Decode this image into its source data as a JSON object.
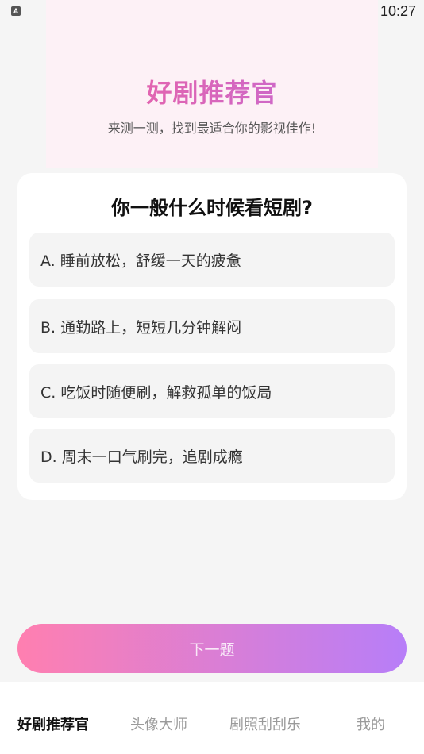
{
  "status_bar": {
    "app_icon_letter": "A",
    "time": "10:27",
    "icons": [
      "wifi-icon",
      "signal-icon",
      "battery-icon"
    ]
  },
  "hero": {
    "title": "好剧推荐官",
    "subtitle": "来测一测，找到最适合你的影视佳作!"
  },
  "quiz": {
    "question": "你一般什么时候看短剧?",
    "options": [
      {
        "label": "A. 睡前放松，舒缓一天的疲惫"
      },
      {
        "label": "B. 通勤路上，短短几分钟解闷"
      },
      {
        "label": "C. 吃饭时随便刷，解救孤单的饭局"
      },
      {
        "label": "D. 周末一口气刷完，追剧成瘾"
      }
    ]
  },
  "next_button": {
    "label": "下一题"
  },
  "tabs": [
    {
      "label": "好剧推荐官",
      "active": true
    },
    {
      "label": "头像大师",
      "active": false
    },
    {
      "label": "剧照刮刮乐",
      "active": false
    },
    {
      "label": "我的",
      "active": false
    }
  ],
  "colors": {
    "accent_start": "#ff7fb0",
    "accent_end": "#b77ef8",
    "hero_bg": "#fdf1f6",
    "page_bg": "#f5f5f5"
  }
}
